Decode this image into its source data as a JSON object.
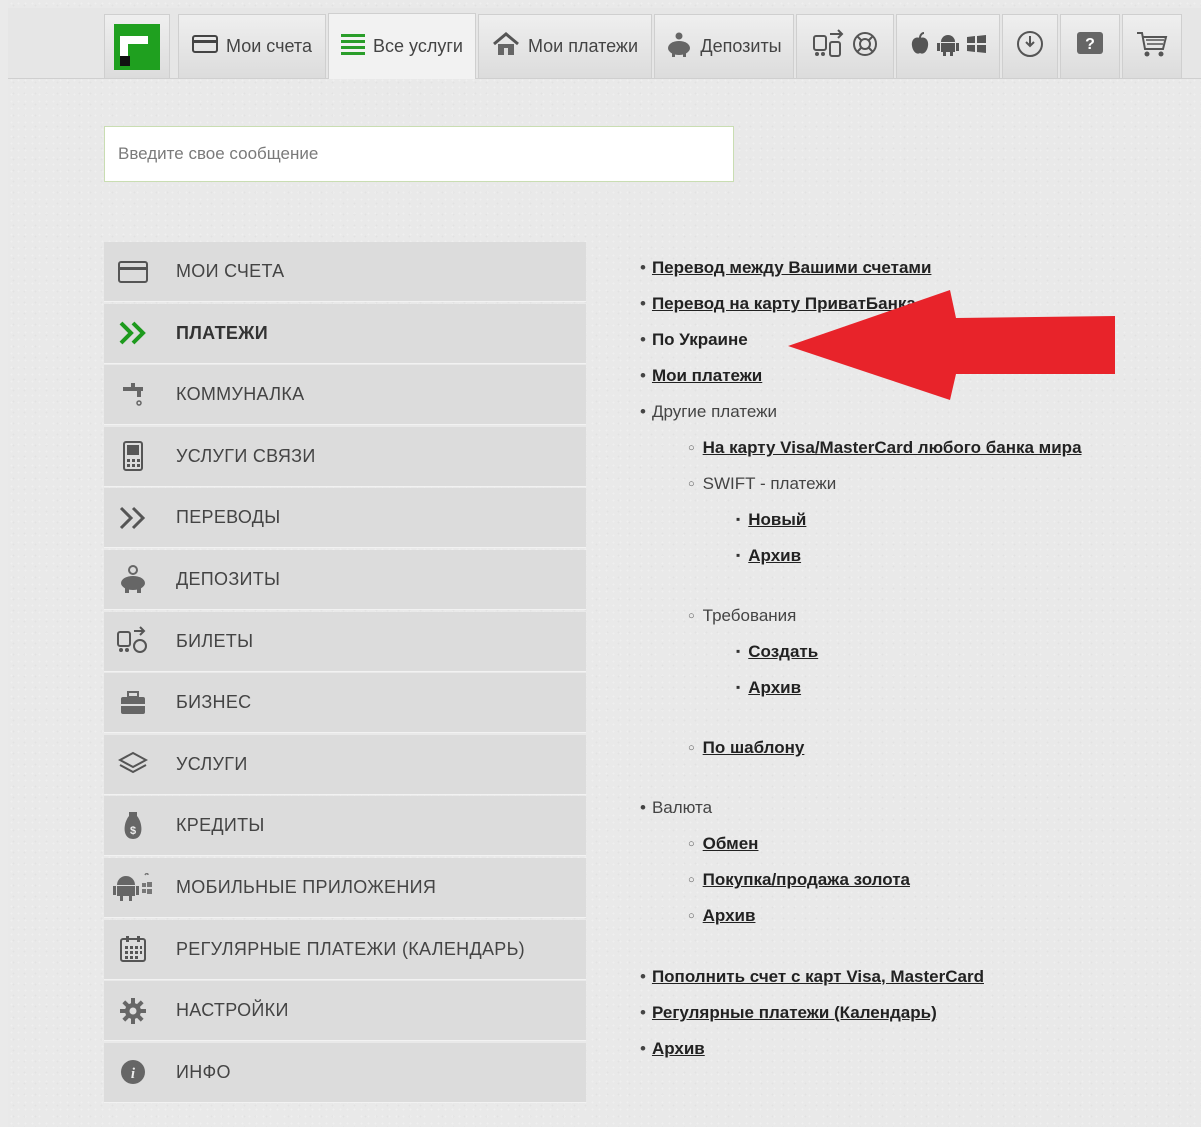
{
  "tabs": [
    {
      "label": "Мои счета",
      "icon": "card-icon"
    },
    {
      "label": "Все услуги",
      "icon": "list-icon"
    },
    {
      "label": "Мои платежи",
      "icon": "house-icon"
    },
    {
      "label": "Депозиты",
      "icon": "piggy-bank-icon"
    }
  ],
  "search": {
    "placeholder": "Введите свое сообщение"
  },
  "menu": [
    {
      "label": "МОИ СЧЕТА",
      "icon": "card-icon"
    },
    {
      "label": "ПЛАТЕЖИ",
      "icon": "double-chevron-icon"
    },
    {
      "label": "КОММУНАЛКА",
      "icon": "faucet-icon"
    },
    {
      "label": "УСЛУГИ СВЯЗИ",
      "icon": "phone-icon"
    },
    {
      "label": "ПЕРЕВОДЫ",
      "icon": "double-chevron-icon"
    },
    {
      "label": "ДЕПОЗИТЫ",
      "icon": "piggy-bank-icon"
    },
    {
      "label": "БИЛЕТЫ",
      "icon": "tickets-icon"
    },
    {
      "label": "БИЗНЕС",
      "icon": "briefcase-icon"
    },
    {
      "label": "УСЛУГИ",
      "icon": "layers-icon"
    },
    {
      "label": "КРЕДИТЫ",
      "icon": "money-bag-icon"
    },
    {
      "label": "МОБИЛЬНЫЕ ПРИЛОЖЕНИЯ",
      "icon": "mobile-apps-icon"
    },
    {
      "label": "РЕГУЛЯРНЫЕ ПЛАТЕЖИ (КАЛЕНДАРЬ)",
      "icon": "calendar-icon"
    },
    {
      "label": "НАСТРОЙКИ",
      "icon": "gear-icon"
    },
    {
      "label": "ИНФО",
      "icon": "info-icon"
    }
  ],
  "links": {
    "transfer_own": "Перевод между Вашими счетами",
    "transfer_card": "Перевод на карту ПриватБанка",
    "ukraine": "По Украине",
    "my_payments": "Мои платежи",
    "other": "Другие платежи",
    "visa_any": "На карту Visa/MasterCard любого банка мира",
    "swift": "SWIFT - платежи",
    "swift_new": "Новый",
    "swift_archive": "Архив",
    "requirements": "Требования",
    "req_create": "Создать",
    "req_archive": "Архив",
    "by_template": "По шаблону",
    "currency": "Валюта",
    "exchange": "Обмен",
    "gold": "Покупка/продажа золота",
    "cur_archive": "Архив",
    "topup": "Пополнить счет с карт Visa, MasterCard",
    "regular": "Регулярные платежи (Календарь)",
    "archive": "Архив"
  },
  "colors": {
    "brand_green": "#2a9d2a",
    "arrow_red": "#e8232a"
  }
}
